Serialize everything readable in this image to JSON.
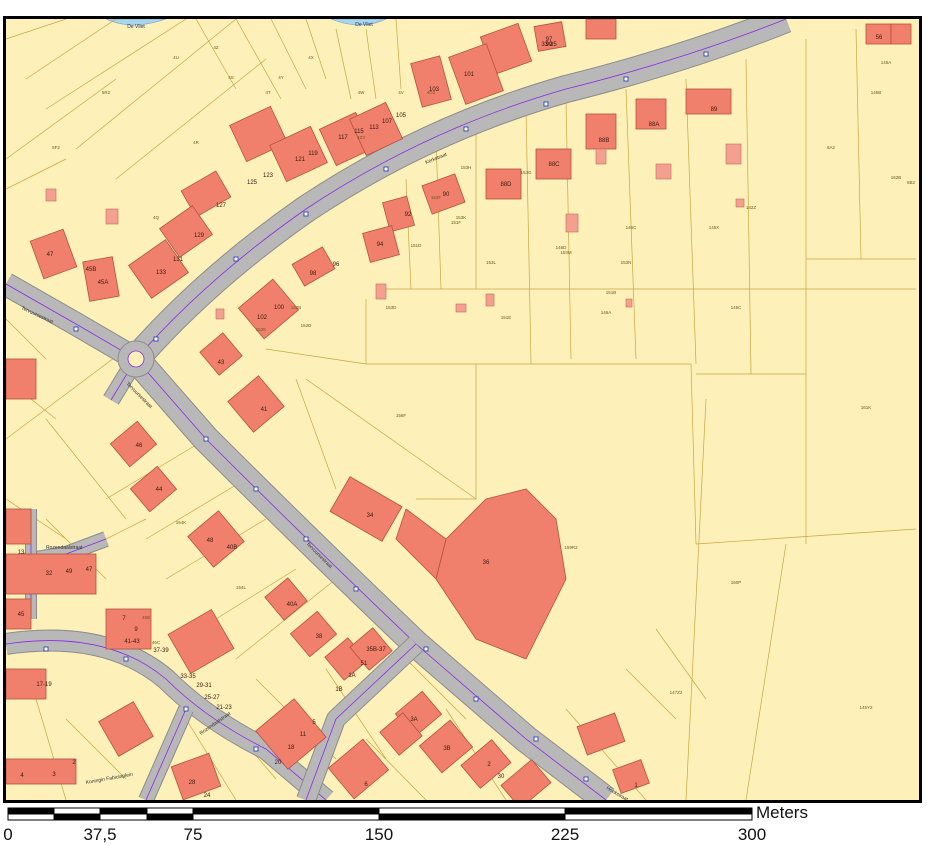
{
  "map": {
    "colors": {
      "land": "#fdf0b8",
      "parcel_line": "#c8a640",
      "building": "#f0806c",
      "road": "#b8b8b8",
      "road_center": "#8a2be2",
      "water": "#a8d4ec"
    },
    "water_labels": [
      "De Vliet",
      "De Vliet"
    ],
    "street_names": [
      "Kerkstraat",
      "Tervuursestraat",
      "Tervuursestraat",
      "Tervuursestraat",
      "Rozendaalstraat",
      "Koningin Fabiolaplein",
      "Rozendaalstraat",
      "Hoekstraat"
    ],
    "house_numbers": [
      "99",
      "97",
      "56",
      "103",
      "101",
      "89",
      "88A",
      "88B",
      "88C",
      "88D",
      "90",
      "92",
      "94",
      "96",
      "98",
      "100",
      "102",
      "105",
      "107",
      "113",
      "115",
      "117",
      "119",
      "121",
      "123",
      "125",
      "127",
      "129",
      "131",
      "133",
      "47",
      "45B",
      "45A",
      "43",
      "41",
      "46",
      "44",
      "48",
      "40B",
      "40A",
      "38",
      "36",
      "34",
      "35B-37",
      "51",
      "1A",
      "1B",
      "3A",
      "3B",
      "2",
      "30",
      "26",
      "28",
      "24",
      "22",
      "20",
      "18",
      "11",
      "5",
      "7",
      "9",
      "41-43",
      "37-39",
      "33-35",
      "29-31",
      "25-27",
      "21-23",
      "17-19",
      "13",
      "32",
      "49",
      "47",
      "45",
      "37",
      "6",
      "4",
      "3",
      "2",
      "1",
      "33-35"
    ],
    "parcel_numbers": [
      "4U",
      "4Z",
      "4Y",
      "4X",
      "4W",
      "4V",
      "4T",
      "4S",
      "4R",
      "4Q",
      "5R2",
      "5F2",
      "4G2",
      "4Z2",
      "6A2",
      "6B2",
      "142Z",
      "145X",
      "146C",
      "146D",
      "151B",
      "151E",
      "151F",
      "151D",
      "152B",
      "152D",
      "152E",
      "153D",
      "153F",
      "153G",
      "153H",
      "153K",
      "153L",
      "153M",
      "153N",
      "154K",
      "154L",
      "156F",
      "159R2",
      "160P",
      "161K",
      "162B",
      "145A",
      "145B",
      "145C",
      "146A",
      "145Y2",
      "147Z2",
      "46B",
      "46C"
    ],
    "icons": [
      "bus-stop-icon"
    ]
  },
  "scale": {
    "unit": "Meters",
    "labels": [
      "0",
      "37,5",
      "75",
      "150",
      "225",
      "300"
    ]
  }
}
